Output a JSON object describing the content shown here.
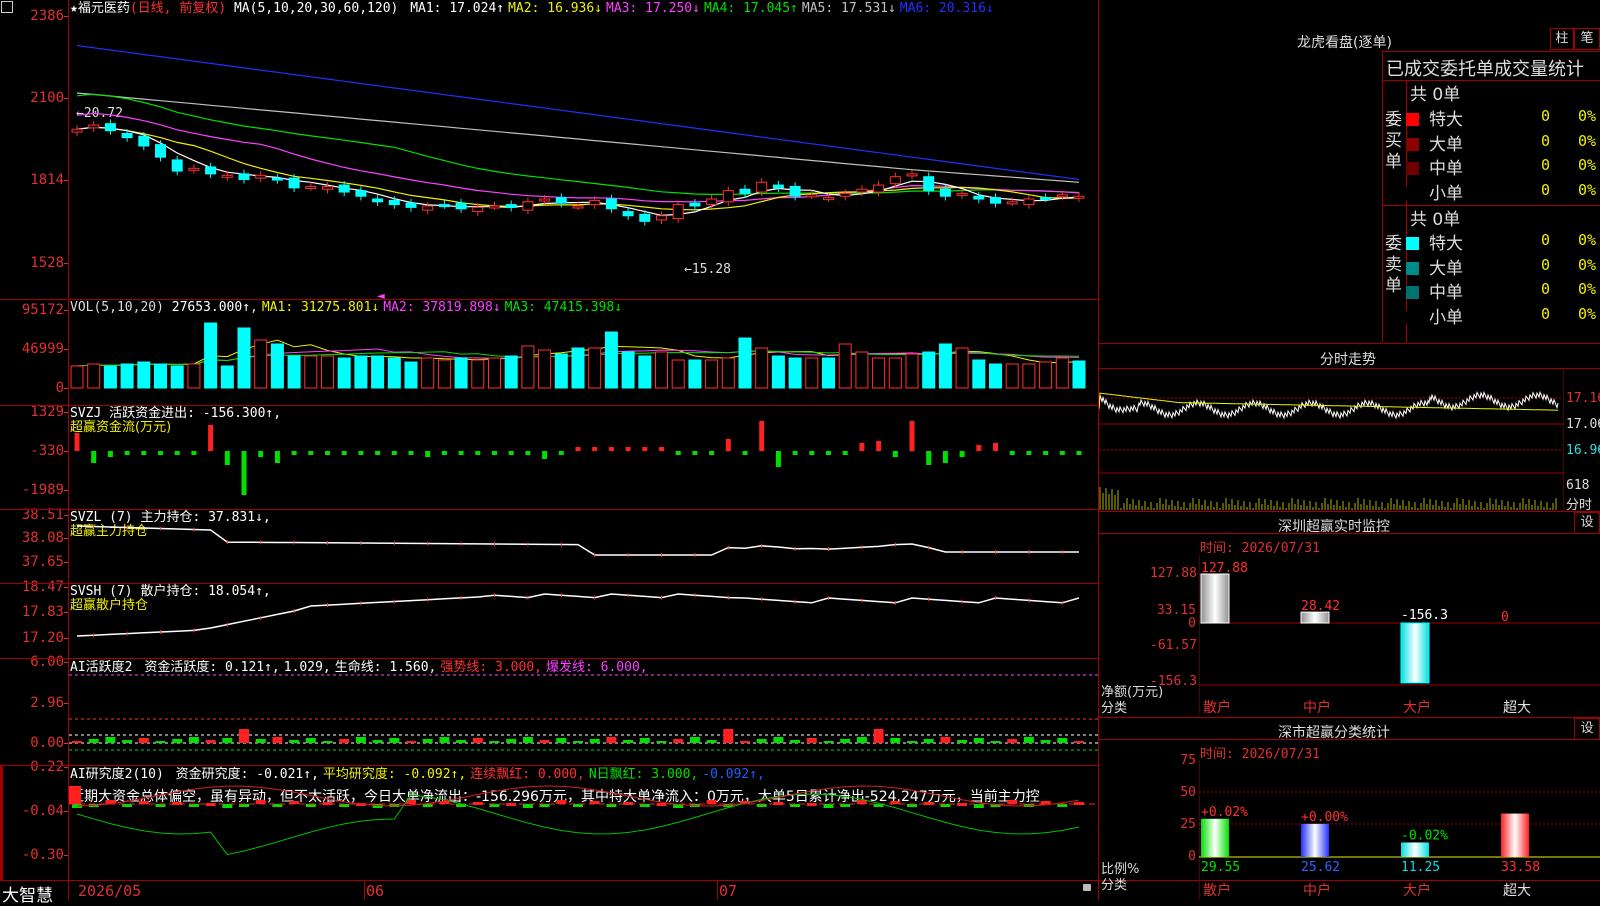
{
  "window": {
    "app_name": "大智慧",
    "corner_icon": "restore-icon"
  },
  "main_chart": {
    "stock_name": "福元医药",
    "period": "(日线, 前复权)",
    "ma_label": "MA(5,10,20,30,60,120)",
    "ma_values": [
      {
        "label": "MA1: 17.024↑",
        "color": "#ffffff"
      },
      {
        "label": "MA2: 16.936↓",
        "color": "#f0f000"
      },
      {
        "label": "MA3: 17.250↓",
        "color": "#ff40ff"
      },
      {
        "label": "MA4: 17.045↑",
        "color": "#00e000"
      },
      {
        "label": "MA5: 17.531↓",
        "color": "#c0c0c0"
      },
      {
        "label": "MA6: 20.316↓",
        "color": "#2030ff"
      }
    ],
    "y_ticks": [
      "2386",
      "2100",
      "1814",
      "1528"
    ],
    "high_note": "←20.72",
    "low_note": "←15.28"
  },
  "volume_panel": {
    "name": "VOL(5,10,20)",
    "value": "27653.000↑",
    "ma": [
      {
        "label": "MA1: 31275.801↓",
        "color": "#f0f000"
      },
      {
        "label": "MA2: 37819.898↓",
        "color": "#ff40ff"
      },
      {
        "label": "MA3: 47415.398↓",
        "color": "#00e000"
      }
    ],
    "y_ticks": [
      "95172",
      "46999",
      "0"
    ]
  },
  "svzj_panel": {
    "name": "SVZJ",
    "line": "活跃资金进出: -156.300↑,",
    "subtitle": "超赢资金流(万元)",
    "y_ticks": [
      "1329",
      "-330",
      "-1989"
    ]
  },
  "svzl_panel": {
    "name": "SVZL (7)",
    "line": "主力持仓: 37.831↓,",
    "subtitle": "超赢主力持仓",
    "y_ticks": [
      "38.51",
      "38.08",
      "37.65"
    ]
  },
  "svsh_panel": {
    "name": "SVSH (7)",
    "line": "散户持仓: 18.054↑,",
    "subtitle": "超赢散户持仓",
    "y_ticks": [
      "18.47",
      "17.83",
      "17.20"
    ]
  },
  "ai_active_panel": {
    "name": "AI活跃度2",
    "items": [
      {
        "label": "资金活跃度: 0.121↑,",
        "color": "#ffffff"
      },
      {
        "label": "1.029,",
        "color": "#ffffff"
      },
      {
        "label": "生命线: 1.560,",
        "color": "#ffffff"
      },
      {
        "label": "强势线: 3.000,",
        "color": "#ff3030"
      },
      {
        "label": "爆发线: 6.000,",
        "color": "#ff40ff"
      }
    ],
    "y_ticks": [
      "6.00",
      "2.96",
      "0.00"
    ]
  },
  "ai_research_panel": {
    "name": "AI研究度2(10)",
    "items": [
      {
        "label": "资金研究度: -0.021↑,",
        "color": "#ffffff"
      },
      {
        "label": "平均研究度: -0.092↑,",
        "color": "#f0f000"
      },
      {
        "label": "连续飘红: 0.000,",
        "color": "#ff3030"
      },
      {
        "label": "N日飘红: 3.000,",
        "color": "#00e000"
      },
      {
        "label": "-0.092↑,",
        "color": "#2060ff"
      }
    ],
    "commentary": "近期大资金总体偏空，虽有异动，但不太活跃，今日大单净流出：-156.296万元，其中特大单净流入：0万元，大单5日累计净出-524.247万元，当前主力控",
    "y_ticks": [
      "0.22",
      "-0.04",
      "-0.30"
    ]
  },
  "x_axis": {
    "labels": [
      "2026/05",
      "06",
      "07"
    ]
  },
  "dragon_tiger": {
    "title": "龙虎看盘(逐单)",
    "tabs": [
      "柱",
      "笔"
    ],
    "subtitle": "已成交委托单成交量统计",
    "buy_side": {
      "label": "委买单",
      "total": "共 0单",
      "rows": [
        {
          "label": "特大",
          "count": "0",
          "pct": "0%",
          "color": "#ff0000"
        },
        {
          "label": "大单",
          "count": "0",
          "pct": "0%",
          "color": "#8b0000"
        },
        {
          "label": "中单",
          "count": "0",
          "pct": "0%",
          "color": "#6b0000"
        },
        {
          "label": "小单",
          "count": "0",
          "pct": "0%",
          "color": "#000000"
        }
      ]
    },
    "sell_side": {
      "label": "委卖单",
      "total": "共 0单",
      "rows": [
        {
          "label": "特大",
          "count": "0",
          "pct": "0%",
          "color": "#00ffff"
        },
        {
          "label": "大单",
          "count": "0",
          "pct": "0%",
          "color": "#008b8b"
        },
        {
          "label": "中单",
          "count": "0",
          "pct": "0%",
          "color": "#007070"
        },
        {
          "label": "小单",
          "count": "0",
          "pct": "0%",
          "color": "#000000"
        }
      ]
    }
  },
  "intraday": {
    "title": "分时走势",
    "price_ticks": [
      "17.16",
      "17.06",
      "16.96"
    ],
    "vol_tick": "618",
    "vol_unit": "分时"
  },
  "sz_monitor": {
    "title": "深圳超赢实时监控",
    "settings": "设",
    "time": "时间: 2026/07/31",
    "y_ticks": [
      "127.88",
      "33.15",
      "0",
      "-61.57",
      "-156.3"
    ],
    "y_unit_lines": [
      "净额(万元)",
      "分类"
    ],
    "categories": [
      "散户",
      "中户",
      "大户",
      "超大"
    ],
    "values": [
      127.88,
      28.42,
      -156.3,
      0
    ],
    "value_labels": [
      "127.88",
      "28.42",
      "-156.3",
      "0"
    ]
  },
  "sz_class": {
    "title": "深市超赢分类统计",
    "settings": "设",
    "time": "时间: 2026/07/31",
    "y_ticks": [
      "75",
      "50",
      "25",
      "0"
    ],
    "y_unit_lines": [
      "比例%",
      "分类"
    ],
    "categories": [
      "散户",
      "中户",
      "大户",
      "超大"
    ],
    "values": [
      29.55,
      25.62,
      11.25,
      33.58
    ],
    "value_labels": [
      "29.55",
      "25.62",
      "11.25",
      "33.58"
    ],
    "change_labels": [
      "+0.02%",
      "+0.00%",
      "-0.02%",
      ""
    ]
  }
}
